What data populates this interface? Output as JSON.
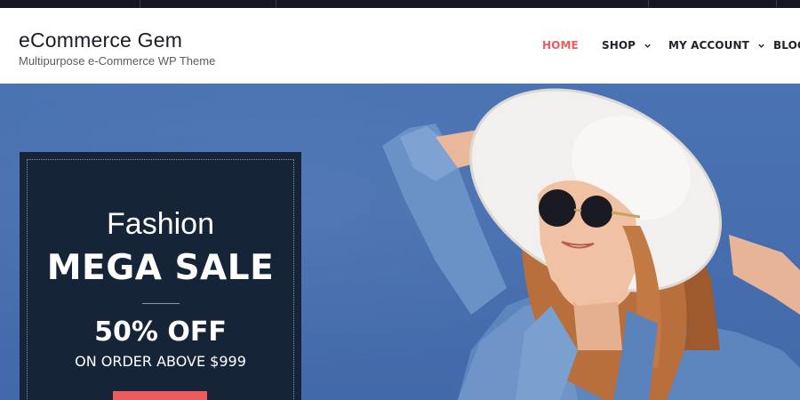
{
  "site": {
    "title": "eCommerce Gem",
    "tagline": "Multipurpose e-Commerce WP Theme"
  },
  "nav": {
    "items": [
      {
        "label": "HOME",
        "active": true,
        "has_dropdown": false
      },
      {
        "label": "SHOP",
        "active": false,
        "has_dropdown": true
      },
      {
        "label": "MY ACCOUNT",
        "active": false,
        "has_dropdown": true
      },
      {
        "label": "BLOG",
        "active": false,
        "has_dropdown": false
      }
    ]
  },
  "hero": {
    "promo": {
      "line1": "Fashion",
      "line2": "MEGA SALE",
      "line3": "50% OFF",
      "line4": "ON ORDER ABOVE $999"
    },
    "image": "woman-in-white-sunhat-and-denim-jacket"
  },
  "colors": {
    "accent": "#ef5a5c",
    "hero_bg": "#4670b1",
    "promo_bg": "#152436",
    "topbar": "#161522"
  }
}
